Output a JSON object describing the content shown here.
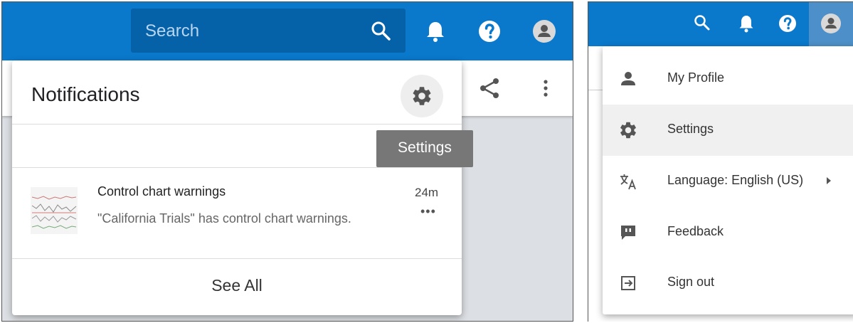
{
  "left": {
    "search": {
      "placeholder": "Search"
    },
    "notifications": {
      "title": "Notifications",
      "tooltip": "Settings",
      "item": {
        "title": "Control chart warnings",
        "time": "24m",
        "more": "•••",
        "body": "\"California Trials\" has control chart warnings."
      },
      "see_all": "See All"
    }
  },
  "right": {
    "menu": [
      {
        "icon": "person-icon",
        "label": "My Profile"
      },
      {
        "icon": "gear-icon",
        "label": "Settings"
      },
      {
        "icon": "translate-icon",
        "label": "Language: English (US)"
      },
      {
        "icon": "feedback-icon",
        "label": "Feedback"
      },
      {
        "icon": "sign-out-icon",
        "label": "Sign out"
      }
    ]
  },
  "colors": {
    "topbar": "#0a79cc",
    "search_bg": "#0561a8",
    "tooltip_bg": "#777777"
  }
}
